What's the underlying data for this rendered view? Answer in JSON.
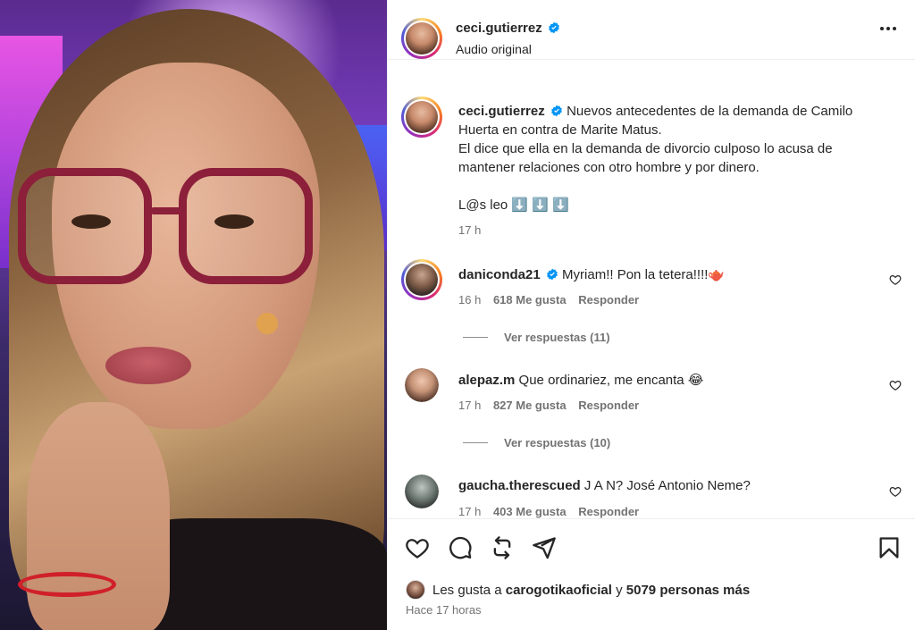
{
  "post": {
    "author": "ceci.gutierrez",
    "audio": "Audio original",
    "caption_lines": [
      "Nuevos antecedentes de la demanda de Camilo",
      "Huerta en contra de Marite Matus.",
      "El dice que ella en la demanda de divorcio culposo lo acusa de",
      "mantener relaciones con otro hombre y por dinero."
    ],
    "caption_tail": "L@s leo ⬇️ ⬇️ ⬇️",
    "caption_time": "17 h"
  },
  "comments": [
    {
      "user": "daniconda21",
      "verified": true,
      "text": "Myriam!! Pon la tetera!!!!🫖",
      "time": "16 h",
      "likes": "618 Me gusta",
      "reply": "Responder",
      "view_replies": "Ver respuestas (11)"
    },
    {
      "user": "alepaz.m",
      "verified": false,
      "text": "Que ordinariez, me encanta 😂",
      "time": "17 h",
      "likes": "827 Me gusta",
      "reply": "Responder",
      "view_replies": "Ver respuestas (10)"
    },
    {
      "user": "gaucha.therescued",
      "verified": false,
      "text": "J A N? José Antonio Neme?",
      "time": "17 h",
      "likes": "403 Me gusta",
      "reply": "Responder"
    }
  ],
  "likes_summary": {
    "prefix": "Les gusta a",
    "user": "carogotikaoficial",
    "middle": "y",
    "rest": "5079 personas más"
  },
  "time_ago": "Hace 17 horas",
  "colors": {
    "verified": "#0095f6",
    "muted_text": "#737373",
    "border": "#efefef"
  },
  "icons": [
    "more-options-icon",
    "verified-icon",
    "heart-icon",
    "comment-icon",
    "repost-icon",
    "share-icon",
    "bookmark-icon"
  ]
}
